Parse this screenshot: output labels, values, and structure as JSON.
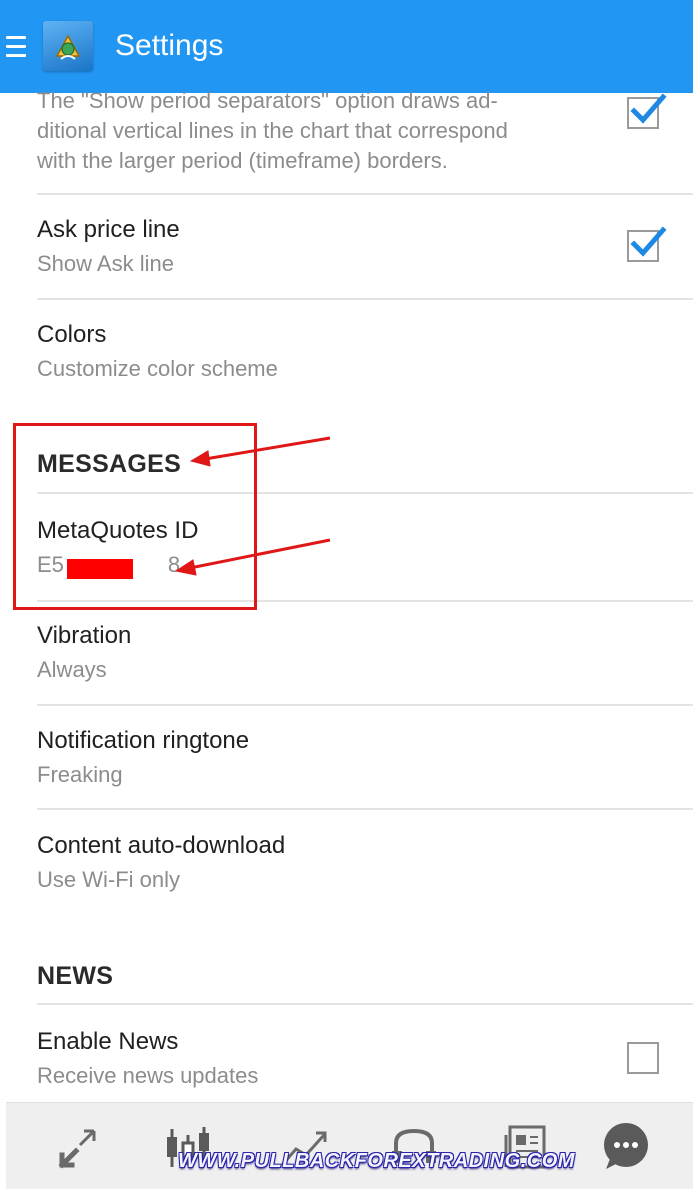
{
  "appbar": {
    "title": "Settings"
  },
  "settings": {
    "period_separators": {
      "description": "The \"Show period separators\" option draws additional vertical lines in the chart that correspond with the larger period (timeframe) borders.",
      "desc_line1": "The \"Show period separators\" option draws ad-",
      "desc_line2": "ditional vertical lines in the chart that correspond",
      "desc_line3": "with the larger period (timeframe) borders.",
      "checked": true
    },
    "ask_price_line": {
      "title": "Ask price line",
      "subtitle": "Show Ask line",
      "checked": true
    },
    "colors": {
      "title": "Colors",
      "subtitle": "Customize color scheme"
    },
    "messages_header": "MESSAGES",
    "metaquotes_id": {
      "title": "MetaQuotes ID",
      "value_prefix": "E5",
      "value_suffix": "8"
    },
    "vibration": {
      "title": "Vibration",
      "subtitle": "Always"
    },
    "notification_ringtone": {
      "title": "Notification ringtone",
      "subtitle": "Freaking"
    },
    "content_auto_download": {
      "title": "Content auto-download",
      "subtitle": "Use Wi-Fi only"
    },
    "news_header": "NEWS",
    "enable_news": {
      "title": "Enable News",
      "subtitle": "Receive news updates",
      "checked": false
    }
  },
  "bottom_nav": {
    "items": [
      {
        "icon": "quotes-arrows-icon"
      },
      {
        "icon": "candlestick-chart-icon"
      },
      {
        "icon": "trend-line-icon"
      },
      {
        "icon": "trade-history-icon"
      },
      {
        "icon": "news-icon"
      },
      {
        "icon": "chat-icon"
      }
    ]
  },
  "watermark": "WWW.PULLBACKFOREXTRADING.COM",
  "colors": {
    "appbar": "#2196f3",
    "accent": "#1e88e5",
    "annotation": "#e01717"
  }
}
